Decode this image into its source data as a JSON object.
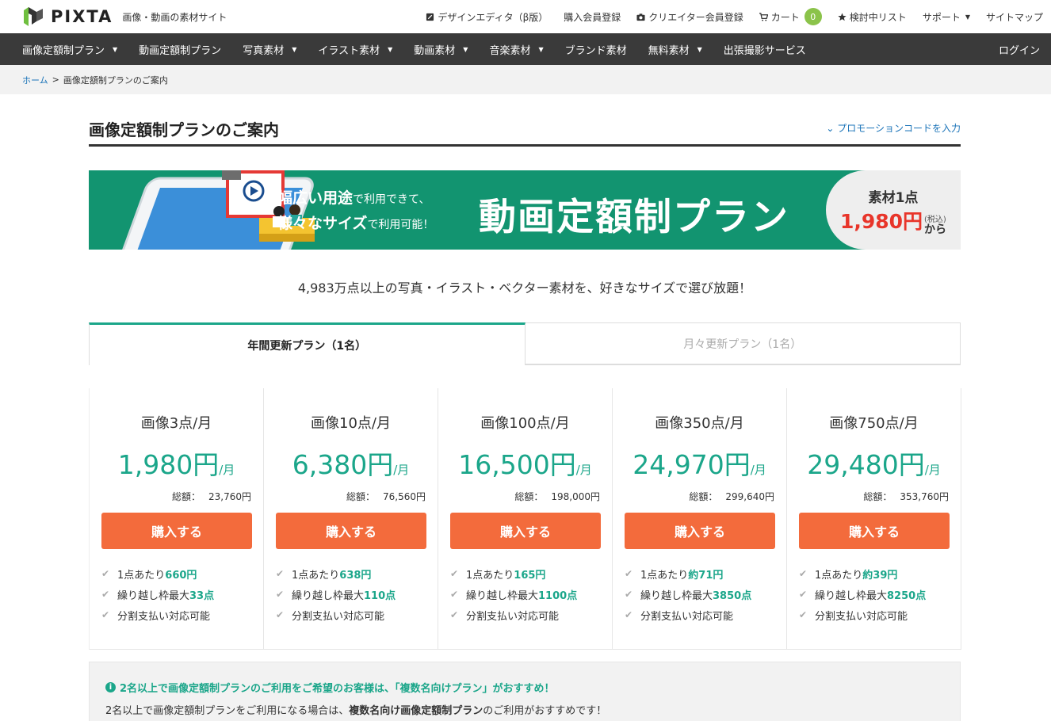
{
  "brand": {
    "name": "PIXTA",
    "tagline": "画像・動画の素材サイト"
  },
  "top_links": [
    {
      "label": "デザインエディタ（β版）",
      "icon": "design-editor-icon"
    },
    {
      "label": "購入会員登録",
      "icon": ""
    },
    {
      "label": "クリエイター会員登録",
      "icon": "camera-icon"
    },
    {
      "label": "カート",
      "icon": "cart-icon",
      "badge": "0"
    },
    {
      "label": "検討中リスト",
      "icon": "star-icon"
    },
    {
      "label": "サポート",
      "icon": ""
    },
    {
      "label": "サイトマップ",
      "icon": ""
    }
  ],
  "nav": {
    "items": [
      {
        "label": "画像定額制プラン",
        "dropdown": true
      },
      {
        "label": "動画定額制プラン",
        "dropdown": false
      },
      {
        "label": "写真素材",
        "dropdown": true
      },
      {
        "label": "イラスト素材",
        "dropdown": true
      },
      {
        "label": "動画素材",
        "dropdown": true
      },
      {
        "label": "音楽素材",
        "dropdown": true
      },
      {
        "label": "ブランド素材",
        "dropdown": false
      },
      {
        "label": "無料素材",
        "dropdown": true
      },
      {
        "label": "出張撮影サービス",
        "dropdown": false
      }
    ],
    "login": "ログイン"
  },
  "breadcrumb": {
    "home": "ホーム",
    "separator": ">",
    "current": "画像定額制プランのご案内"
  },
  "page": {
    "title": "画像定額制プランのご案内",
    "promo_link": "プロモーションコードを入力",
    "subtitle": "4,983万点以上の写真・イラスト・ベクター素材を、好きなサイズで選び放題！"
  },
  "banner": {
    "line1_bold": "幅広い用途",
    "line1_rest": "で利用できて、",
    "line2_bold": "様々なサイズ",
    "line2_rest": "で利用可能！",
    "headline": "動画定額制プラン",
    "price_label": "素材1点",
    "price_value": "1,980円",
    "price_tax": "(税込)",
    "price_suffix": "から"
  },
  "tabs": [
    {
      "label": "年間更新プラン（1名）",
      "active": true
    },
    {
      "label": "月々更新プラン（1名）",
      "active": false
    }
  ],
  "plans": [
    {
      "name": "画像3点/月",
      "price": "1,980円",
      "per": "/月",
      "total_label": "総額：",
      "total": "23,760円",
      "button": "購入する",
      "f1_pre": "1点あたり",
      "f1_val": "660円",
      "f2_pre": "繰り越し枠最大",
      "f2_val": "33点",
      "f3": "分割支払い対応可能"
    },
    {
      "name": "画像10点/月",
      "price": "6,380円",
      "per": "/月",
      "total_label": "総額：",
      "total": "76,560円",
      "button": "購入する",
      "f1_pre": "1点あたり",
      "f1_val": "638円",
      "f2_pre": "繰り越し枠最大",
      "f2_val": "110点",
      "f3": "分割支払い対応可能"
    },
    {
      "name": "画像100点/月",
      "price": "16,500円",
      "per": "/月",
      "total_label": "総額：",
      "total": "198,000円",
      "button": "購入する",
      "f1_pre": "1点あたり",
      "f1_val": "165円",
      "f2_pre": "繰り越し枠最大",
      "f2_val": "1100点",
      "f3": "分割支払い対応可能"
    },
    {
      "name": "画像350点/月",
      "price": "24,970円",
      "per": "/月",
      "total_label": "総額：",
      "total": "299,640円",
      "button": "購入する",
      "f1_pre": "1点あたり",
      "f1_val": "約71円",
      "f2_pre": "繰り越し枠最大",
      "f2_val": "3850点",
      "f3": "分割支払い対応可能"
    },
    {
      "name": "画像750点/月",
      "price": "29,480円",
      "per": "/月",
      "total_label": "総額：",
      "total": "353,760円",
      "button": "購入する",
      "f1_pre": "1点あたり",
      "f1_val": "約39円",
      "f2_pre": "繰り越し枠最大",
      "f2_val": "8250点",
      "f3": "分割支払い対応可能"
    }
  ],
  "info": {
    "heading": "2名以上で画像定額制プランのご利用をご希望のお客様は、「複数名向けプラン」がおすすめ！",
    "body_pre": "2名以上で画像定額制プランをご利用になる場合は、",
    "body_bold": "複数名向け画像定額制プラン",
    "body_post": "のご利用がおすすめです！"
  },
  "colors": {
    "accent": "#1ba68a",
    "banner": "#129470",
    "button": "#f36b3c",
    "nav": "#3a3a3a",
    "cart_badge": "#8bc34a"
  }
}
